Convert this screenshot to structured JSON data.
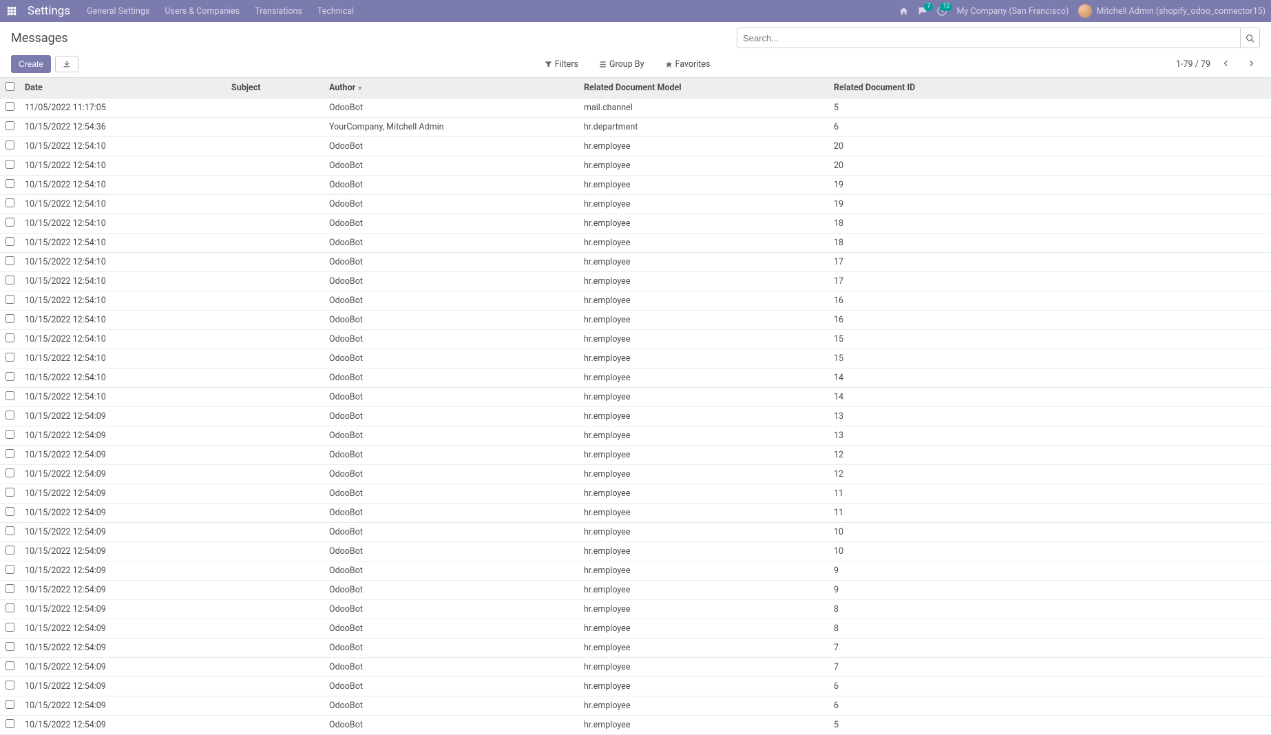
{
  "nav": {
    "brand": "Settings",
    "items": [
      "General Settings",
      "Users & Companies",
      "Translations",
      "Technical"
    ],
    "messages_badge": "7",
    "activities_badge": "12",
    "company": "My Company (San Francisco)",
    "user": "Mitchell Admin (shopify_odoo_connector15)"
  },
  "controlPanel": {
    "breadcrumb": "Messages",
    "search_placeholder": "Search...",
    "create_label": "Create",
    "filters_label": "Filters",
    "groupby_label": "Group By",
    "favorites_label": "Favorites",
    "pager": "1-79 / 79"
  },
  "table": {
    "headers": {
      "date": "Date",
      "subject": "Subject",
      "author": "Author",
      "model": "Related Document Model",
      "doc_id": "Related Document ID"
    },
    "rows": [
      {
        "date": "11/05/2022 11:17:05",
        "subject": "",
        "author": "OdooBot",
        "model": "mail.channel",
        "doc_id": "5"
      },
      {
        "date": "10/15/2022 12:54:36",
        "subject": "",
        "author": "YourCompany, Mitchell Admin",
        "model": "hr.department",
        "doc_id": "6"
      },
      {
        "date": "10/15/2022 12:54:10",
        "subject": "",
        "author": "OdooBot",
        "model": "hr.employee",
        "doc_id": "20"
      },
      {
        "date": "10/15/2022 12:54:10",
        "subject": "",
        "author": "OdooBot",
        "model": "hr.employee",
        "doc_id": "20"
      },
      {
        "date": "10/15/2022 12:54:10",
        "subject": "",
        "author": "OdooBot",
        "model": "hr.employee",
        "doc_id": "19"
      },
      {
        "date": "10/15/2022 12:54:10",
        "subject": "",
        "author": "OdooBot",
        "model": "hr.employee",
        "doc_id": "19"
      },
      {
        "date": "10/15/2022 12:54:10",
        "subject": "",
        "author": "OdooBot",
        "model": "hr.employee",
        "doc_id": "18"
      },
      {
        "date": "10/15/2022 12:54:10",
        "subject": "",
        "author": "OdooBot",
        "model": "hr.employee",
        "doc_id": "18"
      },
      {
        "date": "10/15/2022 12:54:10",
        "subject": "",
        "author": "OdooBot",
        "model": "hr.employee",
        "doc_id": "17"
      },
      {
        "date": "10/15/2022 12:54:10",
        "subject": "",
        "author": "OdooBot",
        "model": "hr.employee",
        "doc_id": "17"
      },
      {
        "date": "10/15/2022 12:54:10",
        "subject": "",
        "author": "OdooBot",
        "model": "hr.employee",
        "doc_id": "16"
      },
      {
        "date": "10/15/2022 12:54:10",
        "subject": "",
        "author": "OdooBot",
        "model": "hr.employee",
        "doc_id": "16"
      },
      {
        "date": "10/15/2022 12:54:10",
        "subject": "",
        "author": "OdooBot",
        "model": "hr.employee",
        "doc_id": "15"
      },
      {
        "date": "10/15/2022 12:54:10",
        "subject": "",
        "author": "OdooBot",
        "model": "hr.employee",
        "doc_id": "15"
      },
      {
        "date": "10/15/2022 12:54:10",
        "subject": "",
        "author": "OdooBot",
        "model": "hr.employee",
        "doc_id": "14"
      },
      {
        "date": "10/15/2022 12:54:10",
        "subject": "",
        "author": "OdooBot",
        "model": "hr.employee",
        "doc_id": "14"
      },
      {
        "date": "10/15/2022 12:54:09",
        "subject": "",
        "author": "OdooBot",
        "model": "hr.employee",
        "doc_id": "13"
      },
      {
        "date": "10/15/2022 12:54:09",
        "subject": "",
        "author": "OdooBot",
        "model": "hr.employee",
        "doc_id": "13"
      },
      {
        "date": "10/15/2022 12:54:09",
        "subject": "",
        "author": "OdooBot",
        "model": "hr.employee",
        "doc_id": "12"
      },
      {
        "date": "10/15/2022 12:54:09",
        "subject": "",
        "author": "OdooBot",
        "model": "hr.employee",
        "doc_id": "12"
      },
      {
        "date": "10/15/2022 12:54:09",
        "subject": "",
        "author": "OdooBot",
        "model": "hr.employee",
        "doc_id": "11"
      },
      {
        "date": "10/15/2022 12:54:09",
        "subject": "",
        "author": "OdooBot",
        "model": "hr.employee",
        "doc_id": "11"
      },
      {
        "date": "10/15/2022 12:54:09",
        "subject": "",
        "author": "OdooBot",
        "model": "hr.employee",
        "doc_id": "10"
      },
      {
        "date": "10/15/2022 12:54:09",
        "subject": "",
        "author": "OdooBot",
        "model": "hr.employee",
        "doc_id": "10"
      },
      {
        "date": "10/15/2022 12:54:09",
        "subject": "",
        "author": "OdooBot",
        "model": "hr.employee",
        "doc_id": "9"
      },
      {
        "date": "10/15/2022 12:54:09",
        "subject": "",
        "author": "OdooBot",
        "model": "hr.employee",
        "doc_id": "9"
      },
      {
        "date": "10/15/2022 12:54:09",
        "subject": "",
        "author": "OdooBot",
        "model": "hr.employee",
        "doc_id": "8"
      },
      {
        "date": "10/15/2022 12:54:09",
        "subject": "",
        "author": "OdooBot",
        "model": "hr.employee",
        "doc_id": "8"
      },
      {
        "date": "10/15/2022 12:54:09",
        "subject": "",
        "author": "OdooBot",
        "model": "hr.employee",
        "doc_id": "7"
      },
      {
        "date": "10/15/2022 12:54:09",
        "subject": "",
        "author": "OdooBot",
        "model": "hr.employee",
        "doc_id": "7"
      },
      {
        "date": "10/15/2022 12:54:09",
        "subject": "",
        "author": "OdooBot",
        "model": "hr.employee",
        "doc_id": "6"
      },
      {
        "date": "10/15/2022 12:54:09",
        "subject": "",
        "author": "OdooBot",
        "model": "hr.employee",
        "doc_id": "6"
      },
      {
        "date": "10/15/2022 12:54:09",
        "subject": "",
        "author": "OdooBot",
        "model": "hr.employee",
        "doc_id": "5"
      }
    ]
  }
}
